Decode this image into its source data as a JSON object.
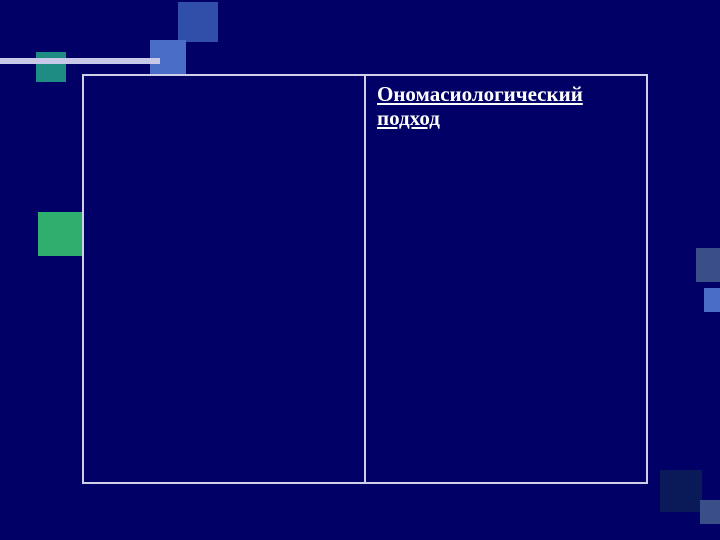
{
  "slide": {
    "heading": "Ономасиологический подход"
  }
}
